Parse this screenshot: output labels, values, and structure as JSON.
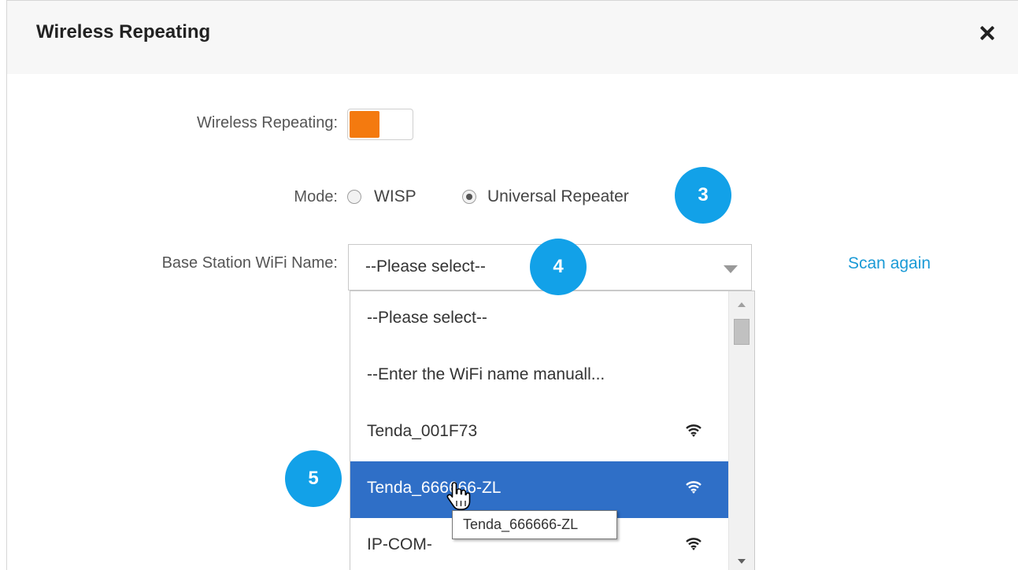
{
  "dialog": {
    "title": "Wireless Repeating",
    "close_icon": "close-icon"
  },
  "form": {
    "wireless_repeating_label": "Wireless Repeating:",
    "wireless_repeating_enabled": true,
    "mode_label": "Mode:",
    "mode_options": [
      {
        "label": "WISP",
        "checked": false
      },
      {
        "label": "Universal Repeater",
        "checked": true
      }
    ],
    "base_station_label": "Base Station WiFi Name:",
    "select_value": "--Please select--",
    "scan_again": "Scan again"
  },
  "dropdown": {
    "options": [
      {
        "label": "--Please select--",
        "signal_icon": null,
        "selected": false
      },
      {
        "label": "--Enter the WiFi name manuall...",
        "signal_icon": null,
        "selected": false
      },
      {
        "label": "Tenda_001F73",
        "signal_icon": "wifi-signal-icon",
        "selected": false
      },
      {
        "label": "Tenda_666666-ZL",
        "signal_icon": "wifi-signal-icon",
        "selected": true
      },
      {
        "label": "IP-COM-",
        "signal_icon": "wifi-signal-icon",
        "selected": false
      }
    ]
  },
  "tooltip": {
    "text": "Tenda_666666-ZL"
  },
  "callouts": {
    "step3": "3",
    "step4": "4",
    "step5": "5"
  },
  "colors": {
    "toggle_on": "#f47a0f",
    "badge": "#12a1e8",
    "selected_row": "#2f6fc7",
    "link": "#1a9ad6"
  }
}
